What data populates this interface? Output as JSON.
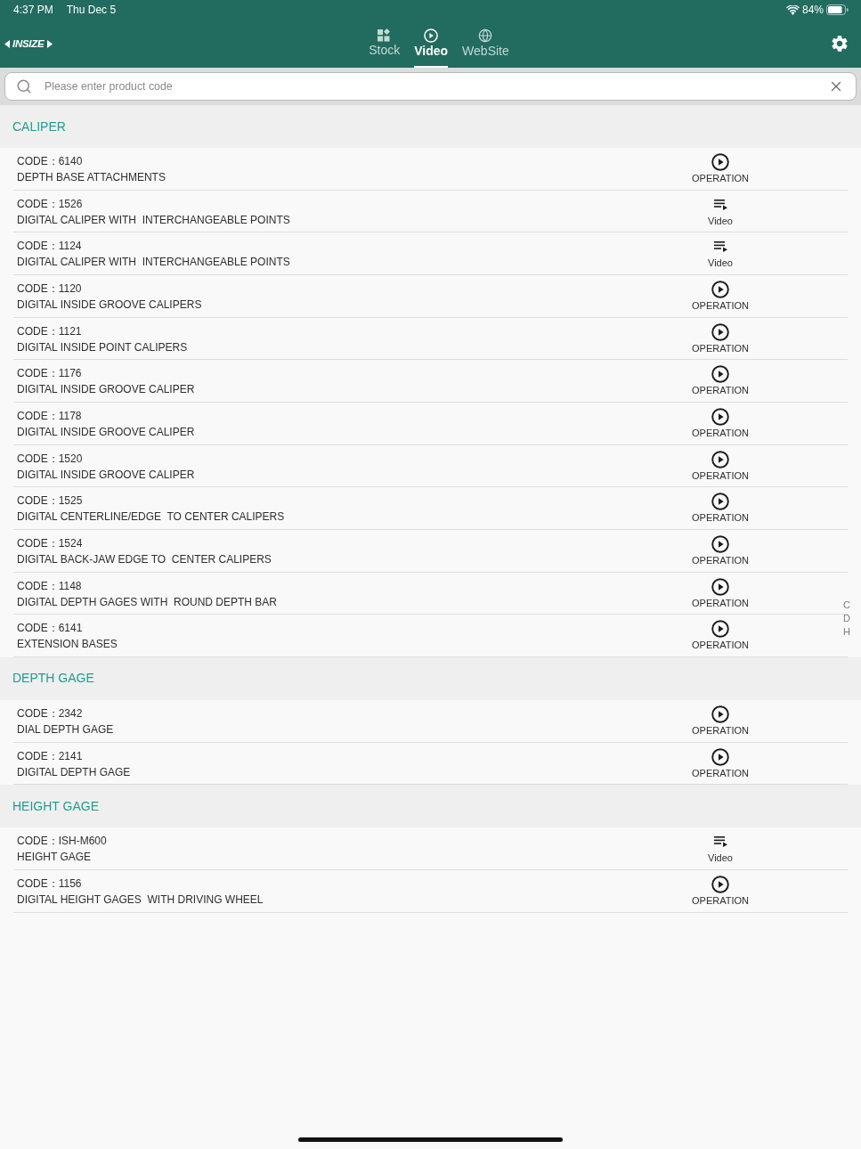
{
  "status_bar": {
    "time": "4:37 PM",
    "date": "Thu Dec 5",
    "battery": "84%"
  },
  "header": {
    "logo_text": "INSIZE",
    "tabs": [
      {
        "kind": "stock",
        "label": "Stock",
        "selected": false
      },
      {
        "kind": "video",
        "label": "Video",
        "selected": true
      },
      {
        "kind": "website",
        "label": "WebSite",
        "selected": false
      }
    ]
  },
  "search": {
    "placeholder": "Please enter product code"
  },
  "sections": [
    {
      "title": "CALIPER",
      "items": [
        {
          "code": "CODE：6140",
          "name": "DEPTH BASE ATTACHMENTS",
          "action": {
            "kind": "operation",
            "label": "OPERATION"
          }
        },
        {
          "code": "CODE：1526",
          "name": "DIGITAL CALIPER WITH  INTERCHANGEABLE POINTS",
          "action": {
            "kind": "video",
            "label": "Video"
          }
        },
        {
          "code": "CODE：1124",
          "name": "DIGITAL CALIPER WITH  INTERCHANGEABLE POINTS",
          "action": {
            "kind": "video",
            "label": "Video"
          }
        },
        {
          "code": "CODE：1120",
          "name": "DIGITAL INSIDE GROOVE CALIPERS",
          "action": {
            "kind": "operation",
            "label": "OPERATION"
          }
        },
        {
          "code": "CODE：1121",
          "name": "DIGITAL INSIDE POINT CALIPERS",
          "action": {
            "kind": "operation",
            "label": "OPERATION"
          }
        },
        {
          "code": "CODE：1176",
          "name": "DIGITAL INSIDE GROOVE CALIPER",
          "action": {
            "kind": "operation",
            "label": "OPERATION"
          }
        },
        {
          "code": "CODE：1178",
          "name": "DIGITAL INSIDE GROOVE CALIPER",
          "action": {
            "kind": "operation",
            "label": "OPERATION"
          }
        },
        {
          "code": "CODE：1520",
          "name": "DIGITAL INSIDE GROOVE CALIPER",
          "action": {
            "kind": "operation",
            "label": "OPERATION"
          }
        },
        {
          "code": "CODE：1525",
          "name": "DIGITAL CENTERLINE/EDGE  TO CENTER CALIPERS",
          "action": {
            "kind": "operation",
            "label": "OPERATION"
          }
        },
        {
          "code": "CODE：1524",
          "name": "DIGITAL BACK-JAW EDGE TO  CENTER CALIPERS",
          "action": {
            "kind": "operation",
            "label": "OPERATION"
          }
        },
        {
          "code": "CODE：1148",
          "name": "DIGITAL DEPTH GAGES WITH  ROUND DEPTH BAR",
          "action": {
            "kind": "operation",
            "label": "OPERATION"
          }
        },
        {
          "code": "CODE：6141",
          "name": "EXTENSION BASES",
          "action": {
            "kind": "operation",
            "label": "OPERATION"
          }
        }
      ]
    },
    {
      "title": "DEPTH GAGE",
      "items": [
        {
          "code": "CODE：2342",
          "name": "DIAL DEPTH GAGE",
          "action": {
            "kind": "operation",
            "label": "OPERATION"
          }
        },
        {
          "code": "CODE：2141",
          "name": "DIGITAL DEPTH GAGE",
          "action": {
            "kind": "operation",
            "label": "OPERATION"
          }
        }
      ]
    },
    {
      "title": "HEIGHT GAGE",
      "items": [
        {
          "code": "CODE：ISH-M600",
          "name": "HEIGHT GAGE",
          "action": {
            "kind": "video",
            "label": "Video"
          }
        },
        {
          "code": "CODE：1156",
          "name": "DIGITAL HEIGHT GAGES  WITH DRIVING WHEEL",
          "action": {
            "kind": "operation",
            "label": "OPERATION"
          }
        }
      ]
    }
  ],
  "index_bar": [
    "C",
    "D",
    "H"
  ]
}
